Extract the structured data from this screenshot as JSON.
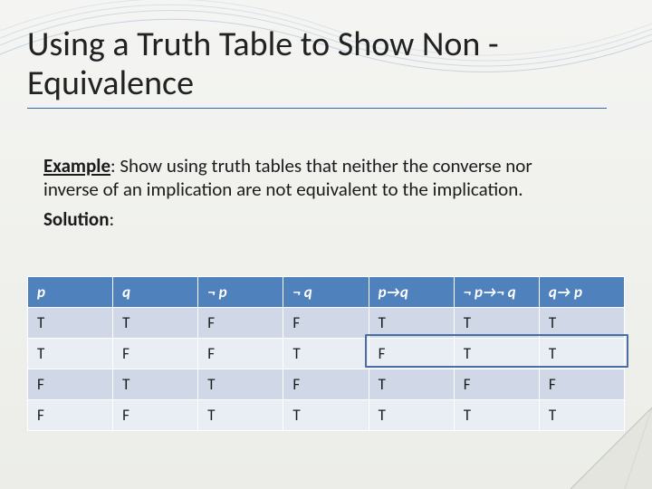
{
  "title": "Using a Truth Table to Show  Non -Equivalence",
  "body": {
    "example_label": "Example",
    "example_text": ": Show using truth tables that neither  the converse nor inverse of an implication are not equivalent to the implication.",
    "solution_label": "Solution",
    "solution_text": ":"
  },
  "table": {
    "headers": [
      "p",
      "q",
      "¬ p",
      "¬ q",
      "p→q",
      "¬ p→¬ q",
      "q→ p"
    ],
    "rows": [
      [
        "T",
        "T",
        "F",
        "F",
        "T",
        "T",
        "T"
      ],
      [
        "T",
        "F",
        "F",
        "T",
        "F",
        "T",
        "T"
      ],
      [
        "F",
        "T",
        "T",
        "F",
        "T",
        "F",
        "F"
      ],
      [
        "F",
        "F",
        "T",
        "T",
        "T",
        "T",
        "T"
      ]
    ]
  }
}
